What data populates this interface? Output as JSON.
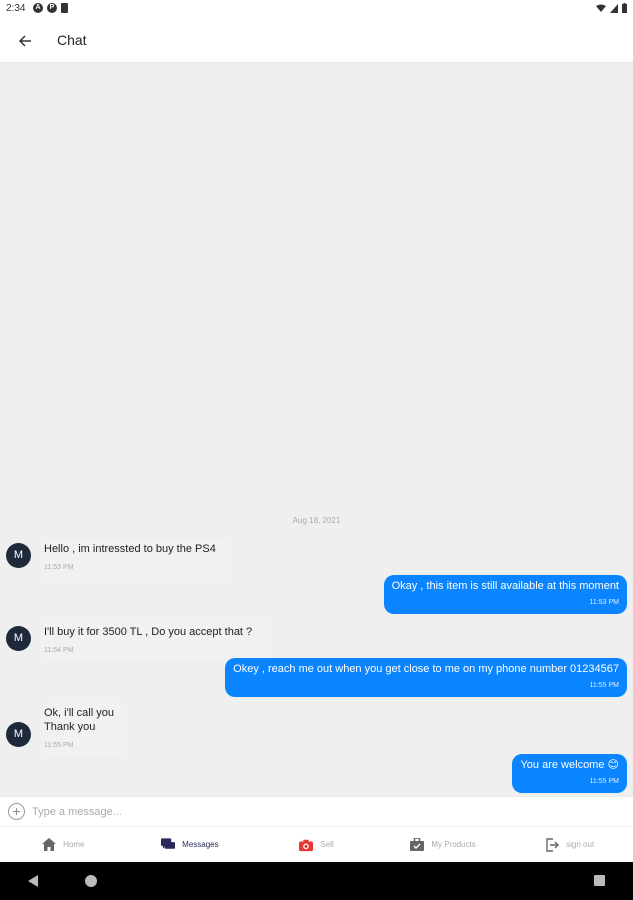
{
  "status_bar": {
    "time": "2:34",
    "icon_a": "A",
    "icon_p": "P"
  },
  "app_bar": {
    "title": "Chat",
    "back_icon": "arrow-left-icon"
  },
  "chat": {
    "date": "Aug 18, 2021",
    "messages": [
      {
        "direction": "in",
        "avatar": "M",
        "text": "Hello , im intressted to buy the PS4",
        "time": "11:53 PM"
      },
      {
        "direction": "out",
        "text": "Okay , this item is still available at this moment",
        "time": "11:53 PM"
      },
      {
        "direction": "in",
        "avatar": "M",
        "text": "I'll buy it for 3500 TL , Do you accept that ?",
        "time": "11:54 PM"
      },
      {
        "direction": "out",
        "text": "Okey , reach me out when you get close to me on my phone number 01234567",
        "time": "11:55 PM"
      },
      {
        "direction": "in",
        "avatar": "M",
        "text_line1": "Ok, i'll call you",
        "text_line2": "Thank you",
        "time": "11:55 PM"
      },
      {
        "direction": "out",
        "text": "You are welcome 😊",
        "time": "11:55 PM"
      }
    ]
  },
  "composer": {
    "placeholder": "Type a message...",
    "value": ""
  },
  "bottom_nav": {
    "items": [
      {
        "label": "Home",
        "icon": "home-icon",
        "active": false
      },
      {
        "label": "Messages",
        "icon": "messages-icon",
        "active": true
      },
      {
        "label": "Sell",
        "icon": "camera-icon",
        "active": false
      },
      {
        "label": "My Products",
        "icon": "briefcase-icon",
        "active": false
      },
      {
        "label": "sign out",
        "icon": "logout-icon",
        "active": false
      }
    ]
  },
  "colors": {
    "accent": "#0a84ff",
    "avatar_bg": "#1e2a3a",
    "active_nav": "#2a2a5a",
    "sell_icon": "#e53935"
  }
}
